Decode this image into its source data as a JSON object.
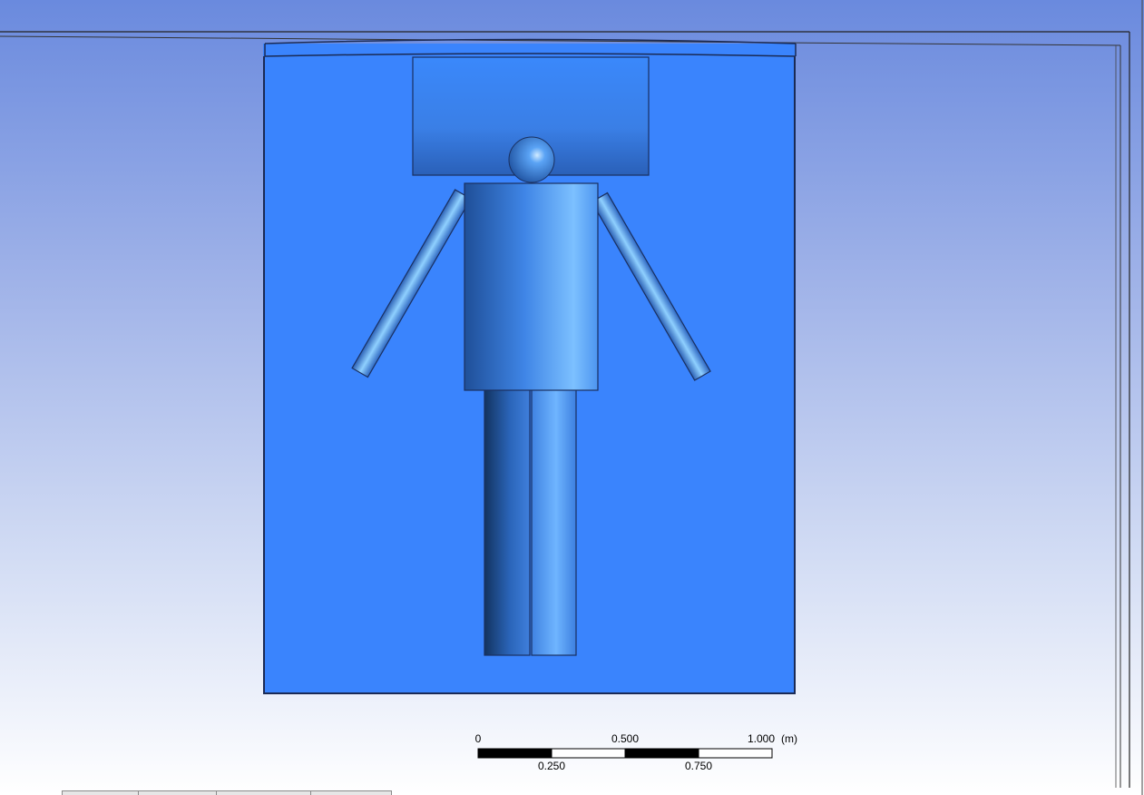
{
  "scale_bar": {
    "unit": "(m)",
    "top_labels": [
      "0",
      "0.500",
      "1.000"
    ],
    "bottom_labels": [
      "0.250",
      "0.750"
    ]
  },
  "colors": {
    "bed": "#3a84fd",
    "body_light": "#7cc0ff",
    "body_dark": "#1f4f98",
    "background_top": "#6a8ade",
    "background_bottom": "#ffffff"
  },
  "tabs": [
    "",
    "",
    "",
    ""
  ]
}
